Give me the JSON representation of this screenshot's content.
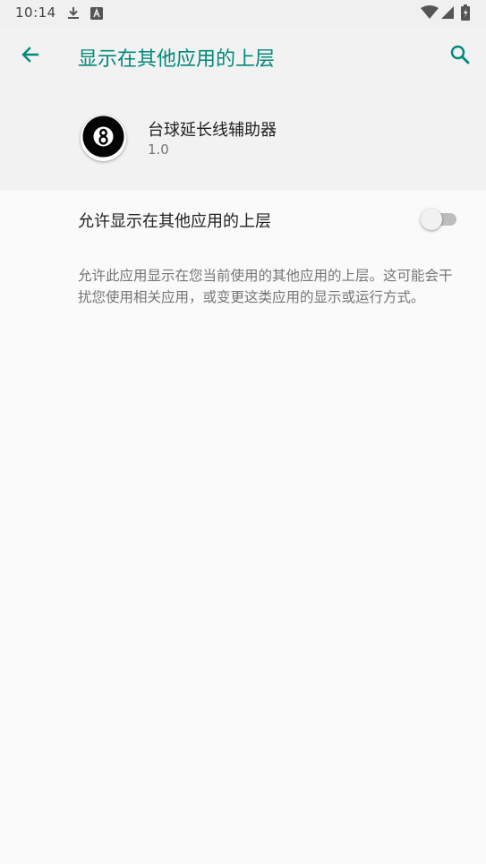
{
  "status_bar": {
    "time": "10:14",
    "left_icons": [
      "download-icon",
      "keyboard-a-icon"
    ],
    "right_icons": [
      "wifi-icon",
      "signal-icon",
      "battery-icon"
    ]
  },
  "app_bar": {
    "title": "显示在其他应用的上层",
    "accent_color": "#00897b",
    "back_icon": "arrow-back-icon",
    "search_icon": "search-icon"
  },
  "app_header": {
    "name": "台球延长线辅助器",
    "version": "1.0",
    "icon": "eight-ball-icon"
  },
  "permission": {
    "label": "允许显示在其他应用的上层",
    "enabled": false
  },
  "description": "允许此应用显示在您当前使用的其他应用的上层。这可能会干扰您使用相关应用，或变更这类应用的显示或运行方式。"
}
